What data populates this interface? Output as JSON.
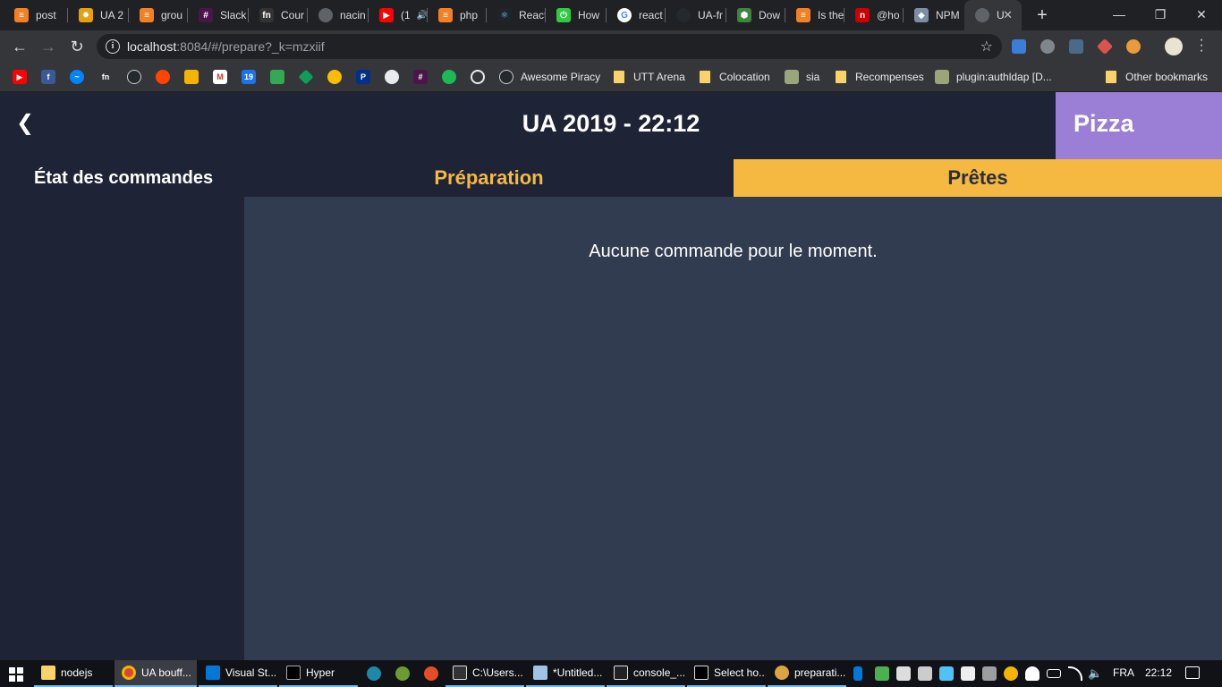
{
  "browser": {
    "tabs": [
      {
        "title": "post",
        "color": "#f48024"
      },
      {
        "title": "UA 2",
        "color": "#e5a00d"
      },
      {
        "title": "grou",
        "color": "#f48024"
      },
      {
        "title": "Slack",
        "color": "#4a154b"
      },
      {
        "title": "Cour",
        "color": "#333333"
      },
      {
        "title": "nacin",
        "color": "#5f6368"
      },
      {
        "title": "(1",
        "color": "#ff0000"
      },
      {
        "title": "php",
        "color": "#f48024"
      },
      {
        "title": "React",
        "color": "#61dafb"
      },
      {
        "title": "How",
        "color": "#2ecc40"
      },
      {
        "title": "react",
        "color": "#4285f4"
      },
      {
        "title": "UA-fr",
        "color": "#24292e"
      },
      {
        "title": "Dow",
        "color": "#3c873a"
      },
      {
        "title": "Is the",
        "color": "#f48024"
      },
      {
        "title": "@ho",
        "color": "#cc0000"
      },
      {
        "title": "NPM",
        "color": "#7c8ea6"
      },
      {
        "title": "U",
        "color": "#5f6368"
      }
    ],
    "url_host": "localhost",
    "url_rest": ":8084/#/prepare?_k=mzxiif",
    "bookmarks": [
      "Awesome Piracy",
      "UTT Arena",
      "Colocation",
      "sia",
      "Recompenses",
      "plugin:authldap [D...",
      "Other bookmarks"
    ]
  },
  "app": {
    "title": "UA 2019 - 22:12",
    "category": "Pizza",
    "sidebar_title": "État des commandes",
    "tab_preparation": "Préparation",
    "tab_ready": "Prêtes",
    "empty_message": "Aucune commande pour le moment.",
    "colors": {
      "background": "#1e2436",
      "content": "#323c50",
      "accent": "#f5b841",
      "category": "#9b7fd6"
    }
  },
  "taskbar": {
    "items": [
      "nodejs",
      "UA bouff...",
      "Visual St...",
      "Hyper",
      "C:\\Users...",
      "*Untitled...",
      "console_...",
      "Select ho...",
      "preparati..."
    ],
    "language": "FRA",
    "time": "22:12"
  }
}
